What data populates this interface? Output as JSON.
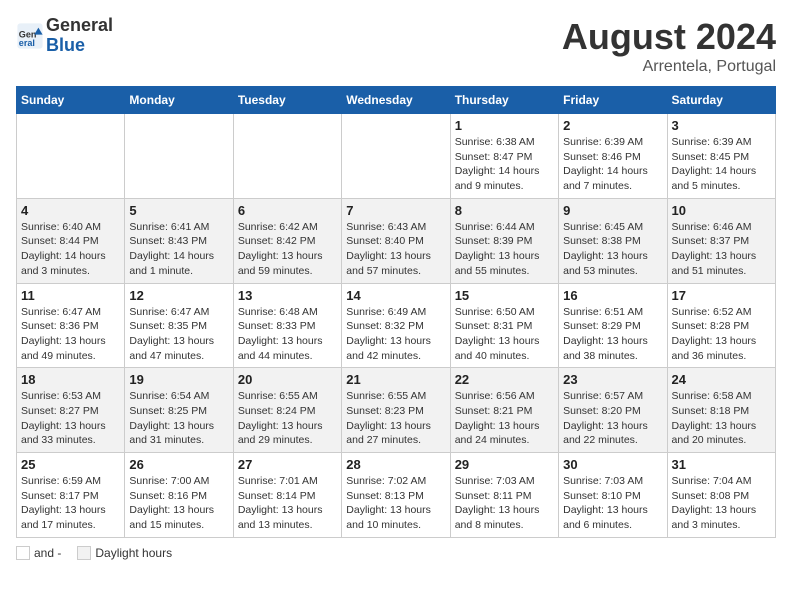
{
  "header": {
    "logo_line1": "General",
    "logo_line2": "Blue",
    "month_year": "August 2024",
    "location": "Arrentela, Portugal"
  },
  "days_of_week": [
    "Sunday",
    "Monday",
    "Tuesday",
    "Wednesday",
    "Thursday",
    "Friday",
    "Saturday"
  ],
  "weeks": [
    [
      {
        "day": "",
        "detail": ""
      },
      {
        "day": "",
        "detail": ""
      },
      {
        "day": "",
        "detail": ""
      },
      {
        "day": "",
        "detail": ""
      },
      {
        "day": "1",
        "detail": "Sunrise: 6:38 AM\nSunset: 8:47 PM\nDaylight: 14 hours and 9 minutes."
      },
      {
        "day": "2",
        "detail": "Sunrise: 6:39 AM\nSunset: 8:46 PM\nDaylight: 14 hours and 7 minutes."
      },
      {
        "day": "3",
        "detail": "Sunrise: 6:39 AM\nSunset: 8:45 PM\nDaylight: 14 hours and 5 minutes."
      }
    ],
    [
      {
        "day": "4",
        "detail": "Sunrise: 6:40 AM\nSunset: 8:44 PM\nDaylight: 14 hours and 3 minutes."
      },
      {
        "day": "5",
        "detail": "Sunrise: 6:41 AM\nSunset: 8:43 PM\nDaylight: 14 hours and 1 minute."
      },
      {
        "day": "6",
        "detail": "Sunrise: 6:42 AM\nSunset: 8:42 PM\nDaylight: 13 hours and 59 minutes."
      },
      {
        "day": "7",
        "detail": "Sunrise: 6:43 AM\nSunset: 8:40 PM\nDaylight: 13 hours and 57 minutes."
      },
      {
        "day": "8",
        "detail": "Sunrise: 6:44 AM\nSunset: 8:39 PM\nDaylight: 13 hours and 55 minutes."
      },
      {
        "day": "9",
        "detail": "Sunrise: 6:45 AM\nSunset: 8:38 PM\nDaylight: 13 hours and 53 minutes."
      },
      {
        "day": "10",
        "detail": "Sunrise: 6:46 AM\nSunset: 8:37 PM\nDaylight: 13 hours and 51 minutes."
      }
    ],
    [
      {
        "day": "11",
        "detail": "Sunrise: 6:47 AM\nSunset: 8:36 PM\nDaylight: 13 hours and 49 minutes."
      },
      {
        "day": "12",
        "detail": "Sunrise: 6:47 AM\nSunset: 8:35 PM\nDaylight: 13 hours and 47 minutes."
      },
      {
        "day": "13",
        "detail": "Sunrise: 6:48 AM\nSunset: 8:33 PM\nDaylight: 13 hours and 44 minutes."
      },
      {
        "day": "14",
        "detail": "Sunrise: 6:49 AM\nSunset: 8:32 PM\nDaylight: 13 hours and 42 minutes."
      },
      {
        "day": "15",
        "detail": "Sunrise: 6:50 AM\nSunset: 8:31 PM\nDaylight: 13 hours and 40 minutes."
      },
      {
        "day": "16",
        "detail": "Sunrise: 6:51 AM\nSunset: 8:29 PM\nDaylight: 13 hours and 38 minutes."
      },
      {
        "day": "17",
        "detail": "Sunrise: 6:52 AM\nSunset: 8:28 PM\nDaylight: 13 hours and 36 minutes."
      }
    ],
    [
      {
        "day": "18",
        "detail": "Sunrise: 6:53 AM\nSunset: 8:27 PM\nDaylight: 13 hours and 33 minutes."
      },
      {
        "day": "19",
        "detail": "Sunrise: 6:54 AM\nSunset: 8:25 PM\nDaylight: 13 hours and 31 minutes."
      },
      {
        "day": "20",
        "detail": "Sunrise: 6:55 AM\nSunset: 8:24 PM\nDaylight: 13 hours and 29 minutes."
      },
      {
        "day": "21",
        "detail": "Sunrise: 6:55 AM\nSunset: 8:23 PM\nDaylight: 13 hours and 27 minutes."
      },
      {
        "day": "22",
        "detail": "Sunrise: 6:56 AM\nSunset: 8:21 PM\nDaylight: 13 hours and 24 minutes."
      },
      {
        "day": "23",
        "detail": "Sunrise: 6:57 AM\nSunset: 8:20 PM\nDaylight: 13 hours and 22 minutes."
      },
      {
        "day": "24",
        "detail": "Sunrise: 6:58 AM\nSunset: 8:18 PM\nDaylight: 13 hours and 20 minutes."
      }
    ],
    [
      {
        "day": "25",
        "detail": "Sunrise: 6:59 AM\nSunset: 8:17 PM\nDaylight: 13 hours and 17 minutes."
      },
      {
        "day": "26",
        "detail": "Sunrise: 7:00 AM\nSunset: 8:16 PM\nDaylight: 13 hours and 15 minutes."
      },
      {
        "day": "27",
        "detail": "Sunrise: 7:01 AM\nSunset: 8:14 PM\nDaylight: 13 hours and 13 minutes."
      },
      {
        "day": "28",
        "detail": "Sunrise: 7:02 AM\nSunset: 8:13 PM\nDaylight: 13 hours and 10 minutes."
      },
      {
        "day": "29",
        "detail": "Sunrise: 7:03 AM\nSunset: 8:11 PM\nDaylight: 13 hours and 8 minutes."
      },
      {
        "day": "30",
        "detail": "Sunrise: 7:03 AM\nSunset: 8:10 PM\nDaylight: 13 hours and 6 minutes."
      },
      {
        "day": "31",
        "detail": "Sunrise: 7:04 AM\nSunset: 8:08 PM\nDaylight: 13 hours and 3 minutes."
      }
    ]
  ],
  "legend": {
    "white_label": "and -",
    "gray_label": "Daylight hours"
  }
}
